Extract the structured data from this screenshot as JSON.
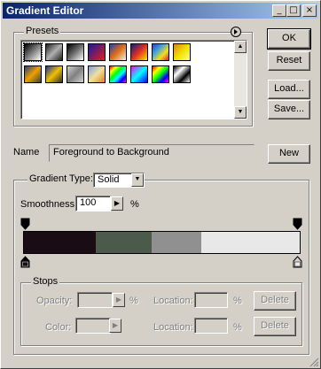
{
  "window": {
    "title": "Gradient Editor"
  },
  "titlebar_buttons": {
    "minimize": "_",
    "maximize": "□",
    "close": "×"
  },
  "buttons": {
    "ok": "OK",
    "reset": "Reset",
    "load": "Load...",
    "save": "Save...",
    "new": "New"
  },
  "presets": {
    "legend": "Presets",
    "menu_icon": "circle-arrow-icon",
    "swatches": [
      {
        "colors": "#000000,#ffffff"
      },
      {
        "colors": "#202020,#b0b0b0,#202020"
      },
      {
        "colors": "#000000,#707070,#ffffff"
      },
      {
        "colors": "#1a1aa0,#e02020"
      },
      {
        "colors": "#2040c0,#e07010,#f0f0f0"
      },
      {
        "colors": "#0a2080,#e03020,#ffe000"
      },
      {
        "colors": "#3040c0,#40a0e0,#f0e020,#e02020"
      },
      {
        "colors": "#e08020,#f0e000,#ffff80"
      },
      {
        "colors": "#204080,#f0a000,#404040"
      },
      {
        "colors": "#2030a0,#f0c000,#303030"
      },
      {
        "colors": "#d0d0d0,#808080,#d0d0d0"
      },
      {
        "colors": "#80a0e0,#f0e0a0,#e08020"
      },
      {
        "colors": "#ff0000,#ffff00,#00ff00,#00ffff,#0000ff,#ff00ff"
      },
      {
        "colors": "#ff00ff,#00ffff,#0000ff"
      },
      {
        "colors": "#ff0000,#ffff00,#00ff00,#0000ff,#ff00ff"
      },
      {
        "colors": "#000000,#ffffff,#000000,#ffffff"
      }
    ]
  },
  "name_field": {
    "label": "Name",
    "value": "Foreground to Background"
  },
  "gradient_type": {
    "label": "Gradient Type:",
    "value": "Solid"
  },
  "smoothness": {
    "label": "Smoothness:",
    "value": "100",
    "unit": "%"
  },
  "gradient_bar": {
    "segments": [
      "#1a0c14",
      "#4c5a4c",
      "#909090",
      "#e8e8e8"
    ]
  },
  "stops": {
    "legend": "Stops",
    "opacity_label": "Opacity:",
    "opacity_unit": "%",
    "opacity_location_label": "Location:",
    "opacity_location_unit": "%",
    "opacity_delete": "Delete",
    "color_label": "Color:",
    "color_location_label": "Location:",
    "color_location_unit": "%",
    "color_delete": "Delete"
  }
}
